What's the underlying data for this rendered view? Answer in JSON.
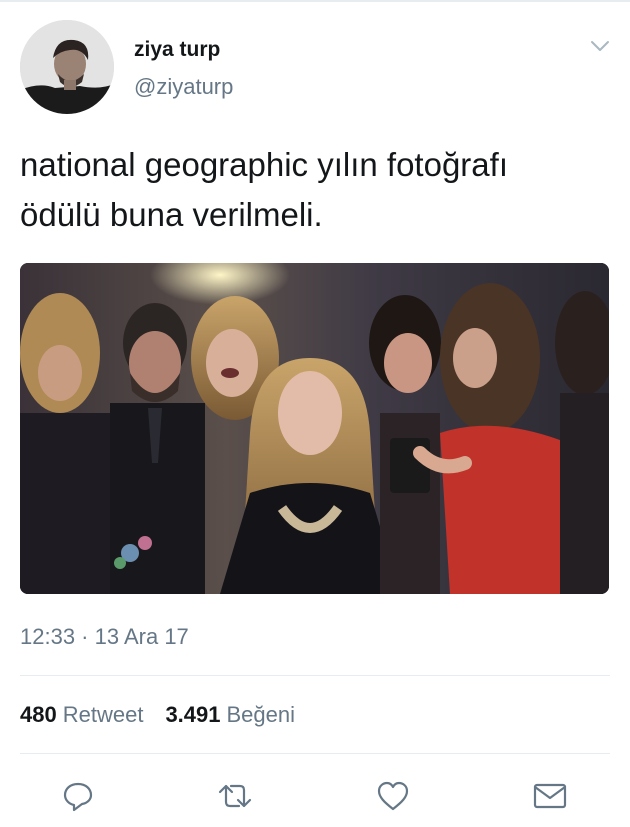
{
  "tweet": {
    "author": {
      "display_name": "ziya turp",
      "handle": "@ziyaturp"
    },
    "text": "national geographic yılın fotoğrafı\nödülü buna verilmeli.",
    "timestamp": "12:33 · 13 Ara 17",
    "stats": {
      "retweets_count": "480",
      "retweets_label": "Retweet",
      "likes_count": "3.491",
      "likes_label": "Beğeni"
    },
    "actions": [
      "reply-icon",
      "retweet-icon",
      "like-icon",
      "share-icon"
    ]
  },
  "colors": {
    "text_primary": "#14171a",
    "text_secondary": "#657786",
    "divider": "#e6ecf0"
  }
}
